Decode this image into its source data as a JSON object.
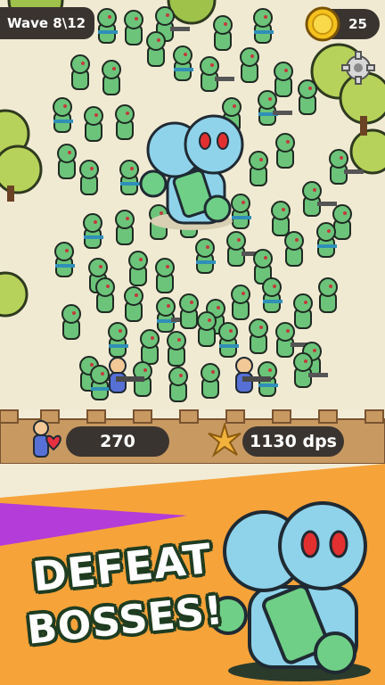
{
  "hud": {
    "wave_label": "Wave 8\\12",
    "coins": "25",
    "coin_icon": "coin-icon",
    "settings_icon": "gear-icon"
  },
  "stats": {
    "health": "270",
    "health_icon": "heart-icon",
    "dps": "1130 dps",
    "dps_icon": "spark-icon"
  },
  "promo": {
    "line1": "DEFEAT",
    "line2": "BOSSES!"
  },
  "colors": {
    "zombie": "#6cc47a",
    "boss": "#8fd3ea",
    "wall": "#c89a62",
    "hud": "#3a3430",
    "promo_orange": "#f6a33a",
    "promo_purple": "#b43cd8"
  }
}
